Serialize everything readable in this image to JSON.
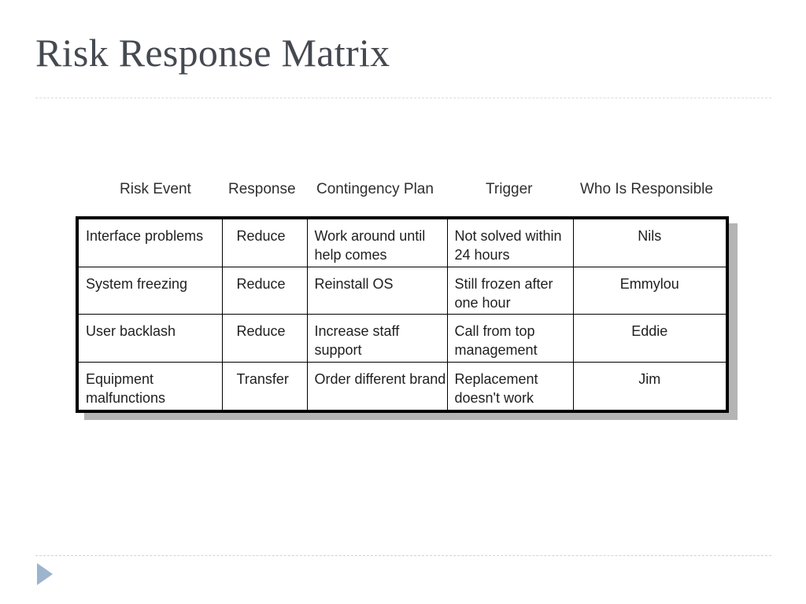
{
  "slide": {
    "title": "Risk Response Matrix",
    "accent_color": "#9cb4ce",
    "title_color": "#454950",
    "background_color": "#ffffff",
    "table_border_color": "#000000",
    "shadow_color": "#b4b4b4"
  },
  "nav": {
    "play_icon": "play-triangle-icon"
  },
  "matrix": {
    "headers": [
      "Risk Event",
      "Response",
      "Contingency Plan",
      "Trigger",
      "Who Is Responsible"
    ],
    "rows": [
      {
        "risk_event": "Interface problems",
        "response": "Reduce",
        "contingency_plan": "Work around until help comes",
        "trigger": "Not solved within 24 hours",
        "who_is_responsible": "Nils"
      },
      {
        "risk_event": "System freezing",
        "response": "Reduce",
        "contingency_plan": "Reinstall OS",
        "trigger": "Still frozen after one hour",
        "who_is_responsible": "Emmylou"
      },
      {
        "risk_event": "User backlash",
        "response": "Reduce",
        "contingency_plan": "Increase staff support",
        "trigger": "Call from top management",
        "who_is_responsible": "Eddie"
      },
      {
        "risk_event": "Equipment malfunctions",
        "response": "Transfer",
        "contingency_plan": "Order different brand",
        "trigger": "Replacement doesn't work",
        "who_is_responsible": "Jim"
      }
    ]
  }
}
